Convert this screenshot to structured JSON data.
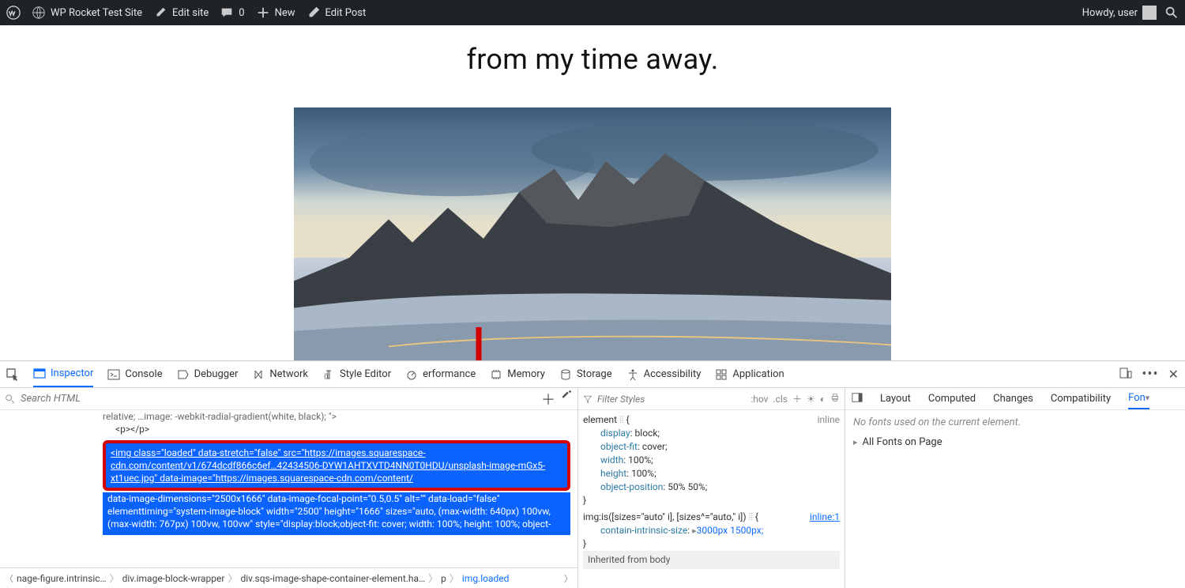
{
  "adminbar": {
    "site": "WP Rocket Test Site",
    "edit_site": "Edit site",
    "comments": "0",
    "new": "New",
    "edit_post": "Edit Post",
    "howdy": "Howdy, user"
  },
  "page": {
    "heading": "from my time away."
  },
  "devtools": {
    "tabs": [
      "Inspector",
      "Console",
      "Debugger",
      "Network",
      "Style Editor",
      "erformance",
      "Memory",
      "Storage",
      "Accessibility",
      "Application"
    ],
    "active_tab": "Inspector",
    "search_placeholder": "Search HTML",
    "html_lines": {
      "pre": "relative; …image: -webkit-radial-gradient(white, black); \">",
      "p": "<p></p>",
      "selected": "<img class=\"loaded\" data-stretch=\"false\" src=\"https://images.squarespace-cdn.com/content/v1/674dcdf866c6ef…42434506-DYW1AHTXVTD4NN0T0HDU/unsplash-image-mGx5-xt1uec.jpg\" data-image=\"https://images.squarespace-cdn.com/content/",
      "rest": "data-image-dimensions=\"2500x1666\" data-image-focal-point=\"0.5,0.5\" alt=\"\" data-load=\"false\" elementtiming=\"system-image-block\" width=\"2500\" height=\"1666\" sizes=\"auto, (max-width: 640px) 100vw, (max-width: 767px) 100vw, 100vw\" style=\"display:block;object-fit: cover; width: 100%; height: 100%; object-"
    },
    "crumbs": [
      "nage-figure.intrinsic…",
      "div.image-block-wrapper",
      "div.sqs-image-shape-container-element.ha…",
      "p",
      "img.loaded"
    ],
    "styles": {
      "filter_placeholder": "Filter Styles",
      "hov": ":hov",
      "cls": ".cls",
      "element_label": "element",
      "inline_label": "inline",
      "rules": [
        {
          "prop": "display",
          "val": "block;"
        },
        {
          "prop": "object-fit",
          "val": "cover;"
        },
        {
          "prop": "width",
          "val": "100%;"
        },
        {
          "prop": "height",
          "val": "100%;"
        },
        {
          "prop": "object-position",
          "val": "50% 50%;"
        }
      ],
      "selector2": "img:is([sizes=\"auto\" i], [sizes^=\"auto,\" i])",
      "inline_link": "inline:1",
      "cis_prop": "contain-intrinsic-size",
      "cis_val": "3000px 1500px;",
      "inherit": "Inherited from body"
    },
    "sidetabs": [
      "Layout",
      "Computed",
      "Changes",
      "Compatibility",
      "Fon"
    ],
    "side_active": "Fon",
    "fonts_msg": "No fonts used on the current element.",
    "fonts_exp": "All Fonts on Page"
  }
}
